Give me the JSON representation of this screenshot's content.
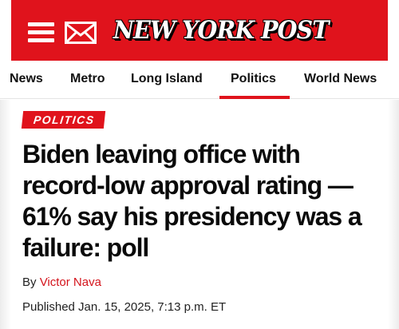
{
  "header": {
    "logo_text": "NEW YORK POST",
    "menu_icon": "hamburger-menu-icon",
    "mail_icon": "envelope-icon",
    "brand_color": "#e0131c"
  },
  "nav": {
    "items": [
      "News",
      "Metro",
      "Long Island",
      "Politics",
      "World News"
    ],
    "active": "Politics"
  },
  "article": {
    "section_tag": "POLITICS",
    "headline": "Biden leaving office with record-low approval rating — 61% say his presidency was a failure: poll",
    "byline_prefix": "By",
    "author": "Victor Nava",
    "published": "Published Jan. 15, 2025, 7:13 p.m. ET"
  }
}
